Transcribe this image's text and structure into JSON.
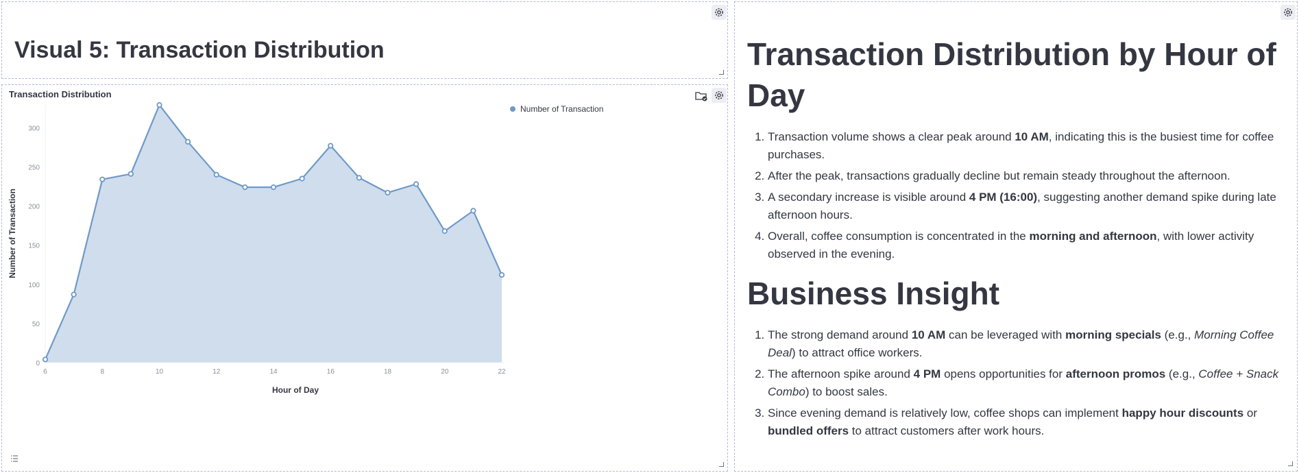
{
  "title_panel": {
    "heading": "Visual 5: Transaction Distribution"
  },
  "chart_panel": {
    "title": "Transaction Distribution"
  },
  "chart_data": {
    "type": "area",
    "title": "Transaction Distribution",
    "xlabel": "Hour of Day",
    "ylabel": "Number of Transaction",
    "x": [
      6,
      7,
      8,
      9,
      10,
      11,
      12,
      13,
      14,
      15,
      16,
      17,
      18,
      19,
      20,
      21,
      22
    ],
    "series": [
      {
        "name": "Number of Transaction",
        "values": [
          4,
          87,
          234,
          241,
          329,
          282,
          240,
          224,
          224,
          235,
          277,
          236,
          217,
          228,
          168,
          194,
          112
        ]
      }
    ],
    "xticks": [
      6,
      8,
      10,
      12,
      14,
      16,
      18,
      20,
      22
    ],
    "yticks": [
      0,
      50,
      100,
      150,
      200,
      250,
      300
    ],
    "xlim": [
      6,
      22
    ],
    "ylim": [
      0,
      330
    ],
    "legend_position": "top-right",
    "grid": false,
    "colors": {
      "line": "#6f99c7",
      "fill": "#cfdded",
      "marker_fill": "#ffffff"
    }
  },
  "markdown": {
    "heading1": "Transaction Distribution by Hour of Day",
    "list1": [
      [
        {
          "t": "Transaction volume shows a clear peak around "
        },
        {
          "t": "10 AM",
          "b": true
        },
        {
          "t": ", indicating this is the busiest time for coffee purchases."
        }
      ],
      [
        {
          "t": "After the peak, transactions gradually decline but remain steady throughout the afternoon."
        }
      ],
      [
        {
          "t": "A secondary increase is visible around "
        },
        {
          "t": "4 PM (16:00)",
          "b": true
        },
        {
          "t": ", suggesting another demand spike during late afternoon hours."
        }
      ],
      [
        {
          "t": "Overall, coffee consumption is concentrated in the "
        },
        {
          "t": "morning and afternoon",
          "b": true
        },
        {
          "t": ", with lower activity observed in the evening."
        }
      ]
    ],
    "heading2": "Business Insight",
    "list2": [
      [
        {
          "t": "The strong demand around "
        },
        {
          "t": "10 AM",
          "b": true
        },
        {
          "t": " can be leveraged with "
        },
        {
          "t": "morning specials",
          "b": true
        },
        {
          "t": " (e.g., "
        },
        {
          "t": "Morning Coffee Deal",
          "i": true
        },
        {
          "t": ") to attract office workers."
        }
      ],
      [
        {
          "t": "The afternoon spike around "
        },
        {
          "t": "4 PM",
          "b": true
        },
        {
          "t": " opens opportunities for "
        },
        {
          "t": "afternoon promos",
          "b": true
        },
        {
          "t": " (e.g., "
        },
        {
          "t": "Coffee + Snack Combo",
          "i": true
        },
        {
          "t": ") to boost sales."
        }
      ],
      [
        {
          "t": "Since evening demand is relatively low, coffee shops can implement "
        },
        {
          "t": "happy hour discounts",
          "b": true
        },
        {
          "t": " or "
        },
        {
          "t": "bundled offers",
          "b": true
        },
        {
          "t": " to attract customers after work hours."
        }
      ]
    ]
  },
  "icons": {
    "gear": "gear-icon",
    "folder": "folder-check-icon",
    "list": "list-icon",
    "resize": "resize-handle-icon"
  }
}
